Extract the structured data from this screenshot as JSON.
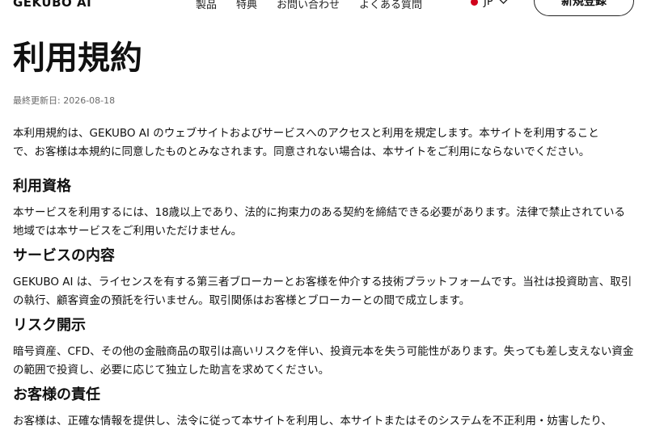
{
  "header": {
    "logo": "GEKUBO AI",
    "nav": [
      "製品",
      "特典",
      "お問い合わせ",
      "よくある質問"
    ],
    "language": "JP",
    "signup_label": "新規登録"
  },
  "main": {
    "title": "利用規約",
    "last_updated": "最終更新日: 2026-08-18",
    "intro": "本利用規約は、GEKUBO AI のウェブサイトおよびサービスへのアクセスと利用を規定します。本サイトを利用することで、お客様は本規約に同意したものとみなされます。同意されない場合は、本サイトをご利用にならないでください。",
    "sections": [
      {
        "heading": "利用資格",
        "body": "本サービスを利用するには、18歳以上であり、法的に拘束力のある契約を締結できる必要があります。法律で禁止されている地域では本サービスをご利用いただけません。"
      },
      {
        "heading": "サービスの内容",
        "body": "GEKUBO AI は、ライセンスを有する第三者ブローカーとお客様を仲介する技術プラットフォームです。当社は投資助言、取引の執行、顧客資金の預託を行いません。取引関係はお客様とブローカーとの間で成立します。"
      },
      {
        "heading": "リスク開示",
        "body": "暗号資産、CFD、その他の金融商品の取引は高いリスクを伴い、投資元本を失う可能性があります。失っても差し支えない資金の範囲で投資し、必要に応じて独立した助言を求めてください。"
      },
      {
        "heading": "お客様の責任",
        "body": "お客様は、正確な情報を提供し、法令に従って本サイトを利用し、本サイトまたはそのシステムを不正利用・妨害したり、"
      }
    ]
  },
  "colors": {
    "text": "#111111",
    "muted": "#6b6b6b",
    "flag": "#d0021b",
    "background": "#ffffff"
  }
}
